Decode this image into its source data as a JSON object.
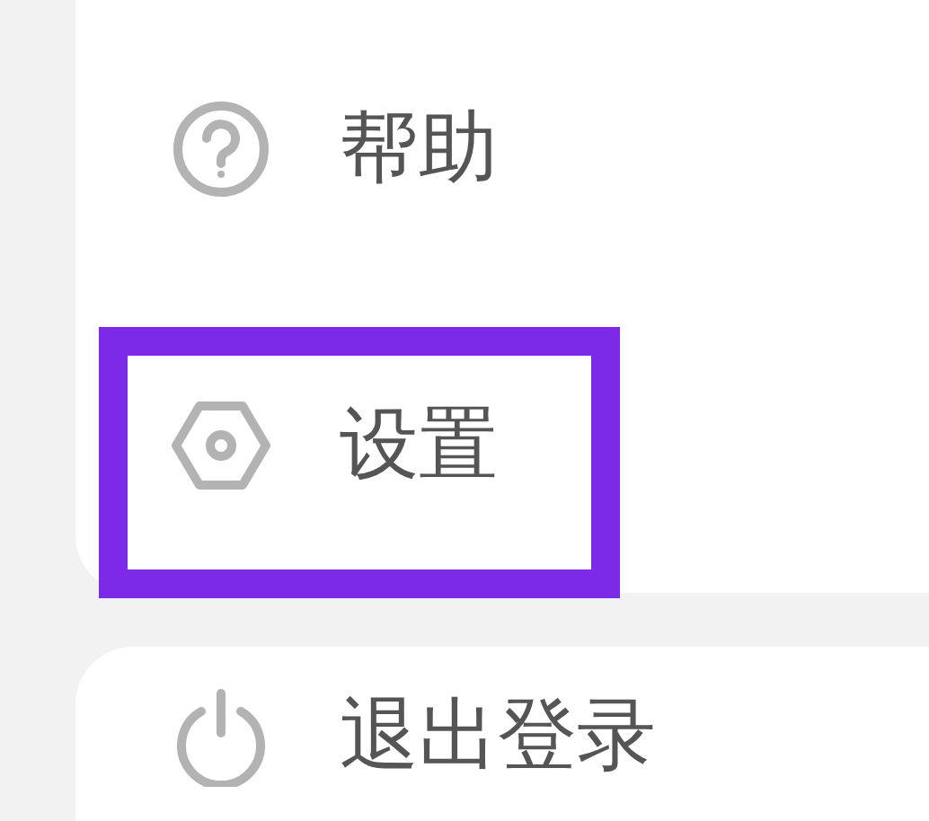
{
  "menu_items": [
    {
      "label": "帮助",
      "kind": "help",
      "highlighted": false
    },
    {
      "label": "设置",
      "kind": "settings",
      "highlighted": true
    }
  ],
  "logout": {
    "label": "退出登录",
    "kind": "power"
  }
}
